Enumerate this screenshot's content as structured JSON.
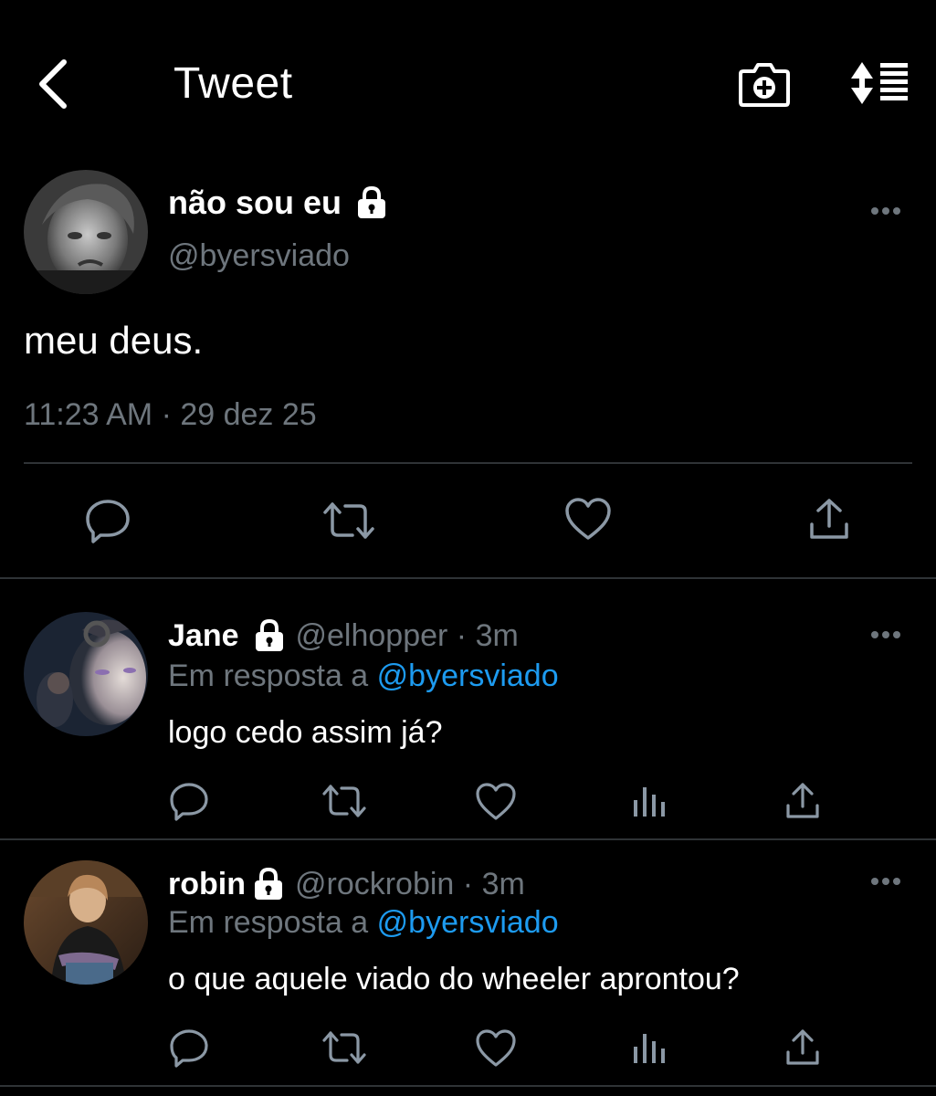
{
  "header": {
    "title": "Tweet",
    "back_icon": "chevron-left-icon",
    "camera_icon": "camera-plus-icon",
    "sort_icon": "sort-list-icon"
  },
  "main_tweet": {
    "name": "não sou eu",
    "handle": "@byersviado",
    "text": "meu deus.",
    "timestamp": "11:23 AM · 29 dez 25",
    "protected": true
  },
  "replies": [
    {
      "name": "Jane",
      "handle": "@elhopper",
      "time": "3m",
      "in_reply_prefix": "Em resposta a",
      "in_reply_to": "@byersviado",
      "text": "logo cedo assim já?",
      "protected": true
    },
    {
      "name": "robin",
      "handle": "@rockrobin",
      "time": "3m",
      "in_reply_prefix": "Em resposta a",
      "in_reply_to": "@byersviado",
      "text": "o que aquele viado do wheeler aprontou?",
      "protected": true
    }
  ],
  "colors": {
    "background": "#000000",
    "text": "#ffffff",
    "muted": "#6e767d",
    "link": "#1d9bf0",
    "separator": "#2f3336"
  }
}
